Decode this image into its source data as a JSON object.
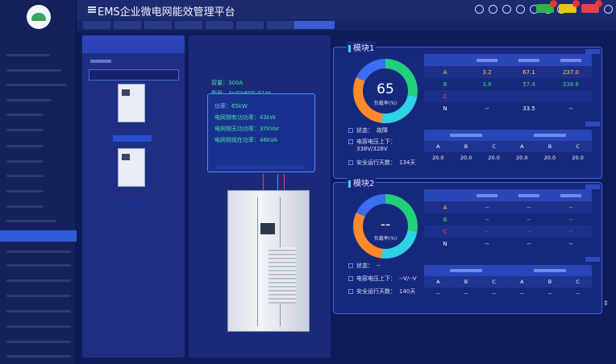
{
  "app": {
    "title": "EMS企业微电网能效管理平台"
  },
  "sidebar": {
    "active_index": 14
  },
  "device_list": {
    "selected_index": 0
  },
  "detail": {
    "rated_current_label": "容量：",
    "rated_current": "300A",
    "model_label": "型号：",
    "model": "AnSin600-G1**",
    "power_label": "功率：",
    "power": "65kW",
    "active_power_label": "电网侧有功功率：",
    "active_power": "43kW",
    "reactive_power_label": "电网侧无功功率：",
    "reactive_power": "37kVar",
    "apparent_power_label": "电网侧视在功率：",
    "apparent_power": "46kVA"
  },
  "modules": [
    {
      "title": "模块1",
      "load_value": "65",
      "load_label": "负载率(%)",
      "phases": [
        {
          "name": "A",
          "c1": "3.2",
          "c2": "67.1",
          "c3": "237.0"
        },
        {
          "name": "B",
          "c1": "3.6",
          "c2": "57.4",
          "c3": "238.6"
        },
        {
          "name": "C",
          "c1": "",
          "c2": "",
          "c3": ""
        },
        {
          "name": "N",
          "c1": "--",
          "c2": "33.5",
          "c3": "--"
        }
      ],
      "status_label": "状态：",
      "status": "故障",
      "voltage_label": "电容电压上下：",
      "voltage": "338V/328V",
      "safe_days_label": "安全运行天数：",
      "safe_days": "134天",
      "igbt_sub": [
        "A",
        "B",
        "C",
        "A",
        "B",
        "C"
      ],
      "igbt_values": [
        "20.0",
        "20.0",
        "20.0",
        "20.0",
        "20.0",
        "20.0"
      ]
    },
    {
      "title": "模块2",
      "load_value": "--",
      "load_label": "负载率(%)",
      "phases": [
        {
          "name": "A",
          "c1": "--",
          "c2": "--",
          "c3": "--"
        },
        {
          "name": "B",
          "c1": "--",
          "c2": "--",
          "c3": "--"
        },
        {
          "name": "C",
          "c1": "--",
          "c2": "--",
          "c3": "--"
        },
        {
          "name": "N",
          "c1": "--",
          "c2": "--",
          "c3": "--"
        }
      ],
      "status_label": "状态：",
      "status": "--",
      "voltage_label": "电容电压上下：",
      "voltage": "--V/--V",
      "safe_days_label": "安全运行天数：",
      "safe_days": "140天",
      "igbt_sub": [
        "A",
        "B",
        "C",
        "A",
        "B",
        "C"
      ],
      "igbt_values": [
        "--",
        "--",
        "--",
        "--",
        "--",
        "--"
      ]
    }
  ],
  "colors": {
    "accent": "#2f5cd9",
    "ring_green": "#21d07a",
    "ring_orange": "#ff8a2a",
    "ring_cyan": "#2fd3e8"
  }
}
